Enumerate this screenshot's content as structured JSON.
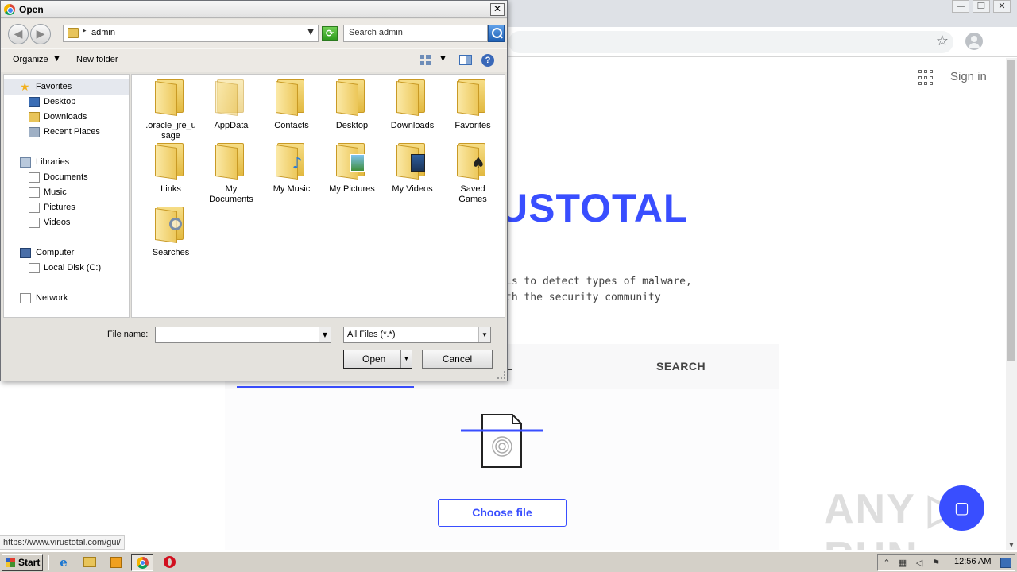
{
  "browser": {
    "win_controls": [
      "—",
      "❐",
      "✕"
    ],
    "star_icon": "star-icon",
    "signin_label": "Sign in",
    "logo_text_visible": "USTOTAL",
    "description_lines": [
      "Ls to detect types of malware,",
      "th the security community"
    ],
    "tab_file_visible": "L",
    "tab_search_label": "SEARCH",
    "choose_file_label": "Choose file",
    "fab_icon": "chat-icon",
    "watermark_text": "ANY ▷ RUN",
    "status_url": "https://www.virustotal.com/gui/",
    "accent_color": "#394eff"
  },
  "dialog": {
    "title": "Open",
    "close_label": "✕",
    "address": {
      "location": "admin"
    },
    "search_placeholder": "Search admin",
    "toolbar": {
      "organize_label": "Organize",
      "new_folder_label": "New folder",
      "help_label": "?"
    },
    "nav": {
      "favorites_label": "Favorites",
      "favorites": [
        "Desktop",
        "Downloads",
        "Recent Places"
      ],
      "libraries_label": "Libraries",
      "libraries": [
        "Documents",
        "Music",
        "Pictures",
        "Videos"
      ],
      "computer_label": "Computer",
      "computer_items": [
        "Local Disk (C:)"
      ],
      "network_label": "Network"
    },
    "files": [
      {
        "label": ".oracle_jre_usage",
        "line1": ".oracle_jre_u",
        "line2": "sage"
      },
      {
        "label": "AppData",
        "line1": "AppData",
        "line2": ""
      },
      {
        "label": "Contacts",
        "line1": "Contacts",
        "line2": ""
      },
      {
        "label": "Desktop",
        "line1": "Desktop",
        "line2": ""
      },
      {
        "label": "Downloads",
        "line1": "Downloads",
        "line2": ""
      },
      {
        "label": "Favorites",
        "line1": "Favorites",
        "line2": ""
      },
      {
        "label": "Links",
        "line1": "Links",
        "line2": ""
      },
      {
        "label": "My Documents",
        "line1": "My",
        "line2": "Documents"
      },
      {
        "label": "My Music",
        "line1": "My Music",
        "line2": ""
      },
      {
        "label": "My Pictures",
        "line1": "My Pictures",
        "line2": ""
      },
      {
        "label": "My Videos",
        "line1": "My Videos",
        "line2": ""
      },
      {
        "label": "Saved Games",
        "line1": "Saved",
        "line2": "Games"
      },
      {
        "label": "Searches",
        "line1": "Searches",
        "line2": ""
      }
    ],
    "file_name_label": "File name:",
    "file_name_value": "",
    "file_type_value": "All Files (*.*)",
    "open_label": "Open",
    "cancel_label": "Cancel"
  },
  "taskbar": {
    "start_label": "Start",
    "clock": "12:56 AM"
  }
}
